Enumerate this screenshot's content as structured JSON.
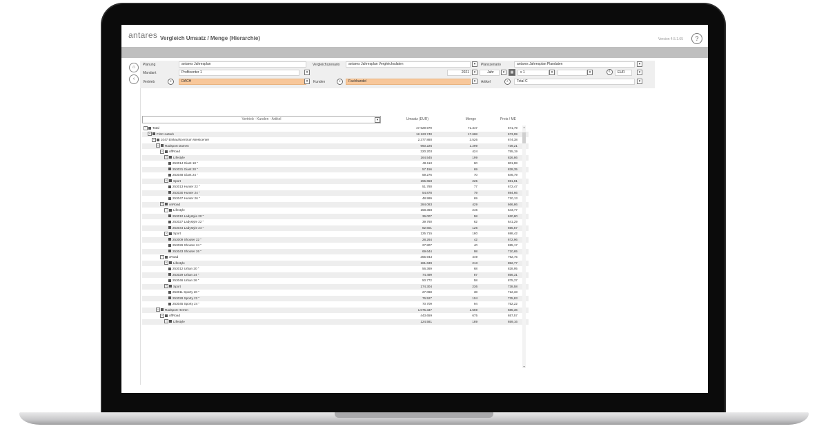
{
  "app": {
    "logo": "antares",
    "title": "Vergleich Umsatz / Menge (Hierarchie)",
    "version": "Version 4.5.1.65",
    "help_icon": "?"
  },
  "icons": {
    "home": "home-icon",
    "back": "back-icon",
    "search": "search-icon",
    "calculator": "calculator-icon",
    "currency": "currency-icon"
  },
  "filters": {
    "planung_label": "Planung",
    "planung_value": "antares Jahresplan",
    "vergleich_label": "Vergleichszenario",
    "vergleich_value": "antares Jahresplan Vergleichsdaten",
    "planszenario_label": "Planszenario",
    "planszenario_value": "antares Jahresplan Plandaten",
    "mandant_label": "Mandant",
    "mandant_value": "Profitcenter 1",
    "jahr_value": "2021",
    "jahr_unit": "Jahr",
    "multiplier": "x 1",
    "currency": "EUR",
    "vertrieb_label": "Vertrieb",
    "vertrieb_value": "DACH",
    "kunden_label": "Kunden",
    "kunden_value": "Fachhandel",
    "artikel_label": "Artikel",
    "artikel_value": "Total C"
  },
  "grid": {
    "dimension_selector": "Vertrieb - Kunden - Artikel",
    "columns": [
      "Umsatz (EUR)",
      "Menge",
      "Preis / ME"
    ],
    "rows": [
      {
        "label": "Total",
        "level": 0,
        "umsatz": "47.929.979",
        "menge": "71.347",
        "preis": "671,79"
      },
      {
        "label": "Fritz Hutterk",
        "level": 1,
        "umsatz": "12.123.740",
        "menge": "17.668",
        "preis": "673,99"
      },
      {
        "label": "1047 Einkaufscentrum Westcenter",
        "level": 2,
        "umsatz": "2.377.880",
        "menge": "3.526",
        "preis": "674,38"
      },
      {
        "label": "Radsport Damen",
        "level": 3,
        "umsatz": "960.226",
        "menge": "1.299",
        "preis": "739,21"
      },
      {
        "label": "offRoad",
        "level": 4,
        "umsatz": "320.203",
        "menge": "424",
        "preis": "755,19"
      },
      {
        "label": "Lifestyle",
        "level": 5,
        "umsatz": "164.545",
        "menge": "199",
        "preis": "826,86"
      },
      {
        "label": "253014 Giant 18 \"",
        "level": 6,
        "umsatz": "48.113",
        "menge": "60",
        "preis": "801,88"
      },
      {
        "label": "253031 Giant 20 \"",
        "level": 6,
        "umsatz": "57.156",
        "menge": "69",
        "preis": "828,35"
      },
      {
        "label": "253048 Giant 24 \"",
        "level": 6,
        "umsatz": "59.276",
        "menge": "70",
        "preis": "846,79"
      },
      {
        "label": "Sport",
        "level": 5,
        "umsatz": "155.658",
        "menge": "225",
        "preis": "691,81"
      },
      {
        "label": "253013 Hunter 22 \"",
        "level": 6,
        "umsatz": "51.780",
        "menge": "77",
        "preis": "672,47"
      },
      {
        "label": "253030 Hunter 24 \"",
        "level": 6,
        "umsatz": "54.878",
        "menge": "79",
        "preis": "694,66"
      },
      {
        "label": "253047 Hunter 26 \"",
        "level": 6,
        "umsatz": "48.999",
        "menge": "69",
        "preis": "710,13"
      },
      {
        "label": "onRoad",
        "level": 4,
        "umsatz": "284.083",
        "menge": "429",
        "preis": "666,86"
      },
      {
        "label": "Lifestyle",
        "level": 5,
        "umsatz": "158.368",
        "menge": "246",
        "preis": "643,77"
      },
      {
        "label": "253010 Ladystyle 20 \"",
        "level": 6,
        "umsatz": "36.007",
        "menge": "58",
        "preis": "620,80"
      },
      {
        "label": "253027 Ladystyle 22 \"",
        "level": 6,
        "umsatz": "39.760",
        "menge": "62",
        "preis": "641,29"
      },
      {
        "label": "253044 Ladystyle 24 \"",
        "level": 6,
        "umsatz": "82.601",
        "menge": "126",
        "preis": "655,57"
      },
      {
        "label": "Sport",
        "level": 5,
        "umsatz": "125.715",
        "menge": "180",
        "preis": "698,42"
      },
      {
        "label": "253009 Shooter 22 \"",
        "level": 6,
        "umsatz": "28.264",
        "menge": "42",
        "preis": "672,96"
      },
      {
        "label": "253026 Shooter 24 \"",
        "level": 6,
        "umsatz": "27.807",
        "menge": "40",
        "preis": "695,17"
      },
      {
        "label": "253043 Shooter 26 \"",
        "level": 6,
        "umsatz": "69.644",
        "menge": "98",
        "preis": "710,65"
      },
      {
        "label": "xRoad",
        "level": 4,
        "umsatz": "355.943",
        "menge": "449",
        "preis": "792,75"
      },
      {
        "label": "Lifestyle",
        "level": 5,
        "umsatz": "181.639",
        "menge": "213",
        "preis": "852,77"
      },
      {
        "label": "253012 Urban 20 \"",
        "level": 6,
        "umsatz": "56.369",
        "menge": "68",
        "preis": "828,95"
      },
      {
        "label": "253029 Urban 24 \"",
        "level": 6,
        "umsatz": "74.499",
        "menge": "87",
        "preis": "856,31"
      },
      {
        "label": "253046 Urban 26 \"",
        "level": 6,
        "umsatz": "50.772",
        "menge": "58",
        "preis": "875,37"
      },
      {
        "label": "Sport",
        "level": 5,
        "umsatz": "174.304",
        "menge": "236",
        "preis": "738,58"
      },
      {
        "label": "253011 Sporty 20 \"",
        "level": 6,
        "umsatz": "27.068",
        "menge": "38",
        "preis": "712,33"
      },
      {
        "label": "253028 Sporty 22 \"",
        "level": 6,
        "umsatz": "76.527",
        "menge": "104",
        "preis": "735,83"
      },
      {
        "label": "253045 Sporty 24 \"",
        "level": 6,
        "umsatz": "70.709",
        "menge": "94",
        "preis": "752,22"
      },
      {
        "label": "Radsport Herren",
        "level": 3,
        "umsatz": "1.075.337",
        "menge": "1.569",
        "preis": "685,36"
      },
      {
        "label": "offRoad",
        "level": 4,
        "umsatz": "443.659",
        "menge": "675",
        "preis": "657,57"
      },
      {
        "label": "Lifestyle",
        "level": 5,
        "umsatz": "124.581",
        "menge": "189",
        "preis": "659,16"
      }
    ]
  },
  "colors": {
    "accent": "#f8c79a",
    "bar": "#bfbfbf"
  }
}
